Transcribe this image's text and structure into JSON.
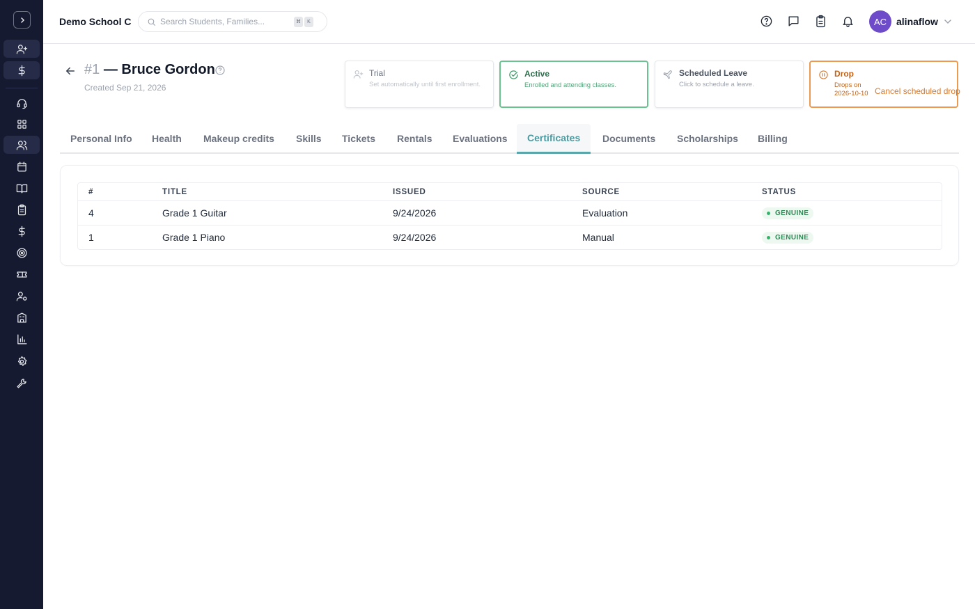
{
  "app": {
    "school_name": "Demo School C",
    "search_placeholder": "Search Students, Families...",
    "shortcut_keys": [
      "⌘",
      "K"
    ],
    "user": {
      "initials": "AC",
      "name": "alinaflow"
    }
  },
  "sidebar": {
    "items": [
      {
        "icon": "user-plus-icon",
        "active": true
      },
      {
        "icon": "dollar-icon",
        "active": true
      },
      {
        "icon": "headset-icon",
        "active": false
      },
      {
        "icon": "dashboard-icon",
        "active": false
      },
      {
        "icon": "users-icon",
        "active": true
      },
      {
        "icon": "calendar-icon",
        "active": false
      },
      {
        "icon": "book-icon",
        "active": false
      },
      {
        "icon": "clipboard-icon",
        "active": false
      },
      {
        "icon": "dollar-icon",
        "active": false
      },
      {
        "icon": "target-icon",
        "active": false
      },
      {
        "icon": "ticket-icon",
        "active": false
      },
      {
        "icon": "user-gear-icon",
        "active": false
      },
      {
        "icon": "building-icon",
        "active": false
      },
      {
        "icon": "bar-chart-icon",
        "active": false
      },
      {
        "icon": "settings-icon",
        "active": false
      },
      {
        "icon": "wrench-icon",
        "active": false
      }
    ]
  },
  "student": {
    "number": "#1",
    "name": "— Bruce Gordon",
    "created": "Created Sep 21, 2026"
  },
  "status_cards": {
    "trial": {
      "title": "Trial",
      "desc": "Set automatically until first enrollment."
    },
    "active": {
      "title": "Active",
      "desc": "Enrolled and attending classes."
    },
    "leave": {
      "title": "Scheduled Leave",
      "desc": "Click to schedule a leave."
    },
    "drop": {
      "title": "Drop",
      "desc": "Drops on 2026-10-10",
      "action": "Cancel scheduled drop"
    }
  },
  "tabs": [
    {
      "label": "Personal Info",
      "active": false
    },
    {
      "label": "Health",
      "active": false
    },
    {
      "label": "Makeup credits",
      "active": false
    },
    {
      "label": "Skills",
      "active": false
    },
    {
      "label": "Tickets",
      "active": false
    },
    {
      "label": "Rentals",
      "active": false
    },
    {
      "label": "Evaluations",
      "active": false
    },
    {
      "label": "Certificates",
      "active": true
    },
    {
      "label": "Documents",
      "active": false
    },
    {
      "label": "Scholarships",
      "active": false
    },
    {
      "label": "Billing",
      "active": false
    }
  ],
  "certificates": {
    "columns": [
      "#",
      "TITLE",
      "ISSUED",
      "SOURCE",
      "STATUS"
    ],
    "rows": [
      {
        "num": "4",
        "title": "Grade 1 Guitar",
        "issued": "9/24/2026",
        "source": "Evaluation",
        "status": "GENUINE"
      },
      {
        "num": "1",
        "title": "Grade 1 Piano",
        "issued": "9/24/2026",
        "source": "Manual",
        "status": "GENUINE"
      }
    ]
  }
}
